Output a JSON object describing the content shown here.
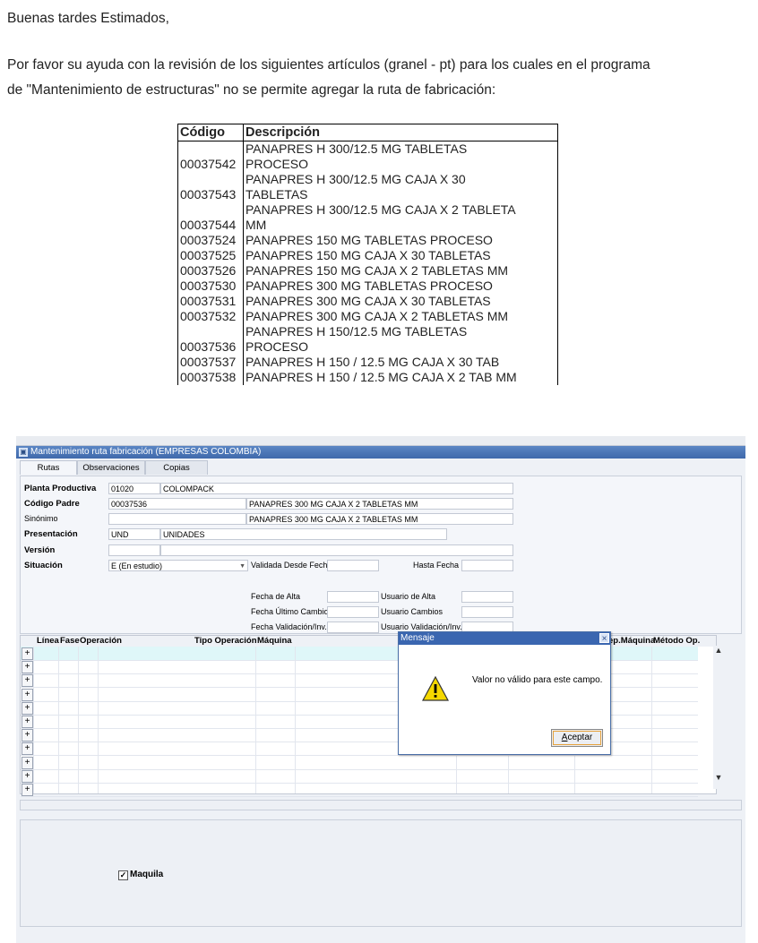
{
  "email": {
    "greeting": "Buenas tardes Estimados,",
    "line1": "Por favor su ayuda con la revisión de los siguientes artículos (granel - pt) para los cuales en el programa",
    "line2": "de \"Mantenimiento de estructuras\" no se permite agregar la ruta de fabricación:"
  },
  "items_table": {
    "headers": [
      "Código",
      "Descripción"
    ],
    "rows": [
      {
        "code": "00037542",
        "desc1": "PANAPRES H 300/12.5 MG TABLETAS",
        "desc2": "PROCESO"
      },
      {
        "code": "00037543",
        "desc1": "PANAPRES H 300/12.5 MG CAJA X 30",
        "desc2": "TABLETAS"
      },
      {
        "code": "00037544",
        "desc1": "PANAPRES H 300/12.5 MG CAJA X 2 TABLETA",
        "desc2": "MM"
      },
      {
        "code": "00037524",
        "desc1": "",
        "desc2": "PANAPRES 150 MG TABLETAS PROCESO"
      },
      {
        "code": "00037525",
        "desc1": "",
        "desc2": "PANAPRES 150 MG CAJA X 30 TABLETAS"
      },
      {
        "code": "00037526",
        "desc1": "",
        "desc2": "PANAPRES 150 MG CAJA X 2 TABLETAS MM"
      },
      {
        "code": "00037530",
        "desc1": "",
        "desc2": "PANAPRES 300 MG TABLETAS PROCESO"
      },
      {
        "code": "00037531",
        "desc1": "",
        "desc2": "PANAPRES 300 MG CAJA X 30 TABLETAS"
      },
      {
        "code": "00037532",
        "desc1": "",
        "desc2": "PANAPRES 300 MG CAJA X 2 TABLETAS MM"
      },
      {
        "code": "00037536",
        "desc1": "PANAPRES H 150/12.5 MG TABLETAS",
        "desc2": "PROCESO"
      },
      {
        "code": "00037537",
        "desc1": "",
        "desc2": "PANAPRES H 150 / 12.5 MG CAJA X 30 TAB"
      },
      {
        "code": "00037538",
        "desc1": "",
        "desc2": "PANAPRES H 150 / 12.5 MG CAJA X 2 TAB MM"
      }
    ]
  },
  "app": {
    "title": "Mantenimiento ruta fabricación (EMPRESAS COLOMBIA)",
    "tabs": [
      "Rutas",
      "Observaciones",
      "Copias"
    ],
    "form": {
      "planta_label": "Planta Productiva",
      "planta_code": "01020",
      "planta_name": "COLOMPACK",
      "codigo_label": "Código Padre",
      "codigo_value": "00037536",
      "codigo_desc": "PANAPRES 300 MG CAJA X 2 TABLETAS MM",
      "sinonimo_label": "Sinónimo",
      "sinonimo_desc": "PANAPRES 300 MG CAJA X 2 TABLETAS MM",
      "presentacion_label": "Presentación",
      "presentacion_code": "UND",
      "presentacion_name": "UNIDADES",
      "version_label": "Versión",
      "situacion_label": "Situación",
      "situacion_value": "E (En estudio)",
      "validada_label": "Validada Desde Fecha",
      "hasta_label": "Hasta Fecha",
      "fecha_alta_label": "Fecha de Alta",
      "usuario_alta_label": "Usuario de Alta",
      "fecha_cambio_label": "Fecha Último Cambio",
      "usuario_cambios_label": "Usuario Cambios",
      "fecha_valid_label": "Fecha Validación/Inv.",
      "usuario_valid_label": "Usuario Validación/Inv."
    },
    "grid_headers": [
      "Línea",
      "Fase",
      "Operación",
      "Tipo Operación",
      "Máquina",
      "ep.Máquina",
      "Método Op."
    ],
    "maquila_label": "Maquila"
  },
  "dialog": {
    "title": "Mensaje",
    "message": "Valor no válido para este campo.",
    "accept_label": "Aceptar",
    "accept_accel": "A",
    "accept_rest": "ceptar"
  }
}
